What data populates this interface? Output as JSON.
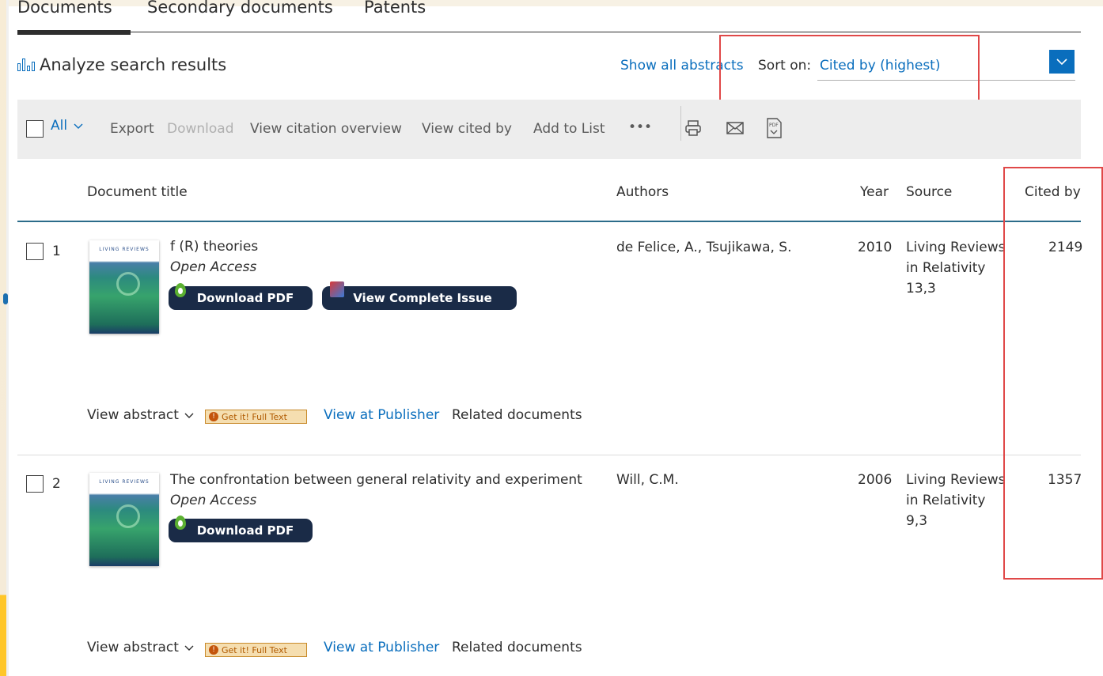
{
  "tabs": [
    {
      "label": "Documents"
    },
    {
      "label": "Secondary documents"
    },
    {
      "label": "Patents"
    }
  ],
  "analyze": {
    "label": "Analyze search results",
    "icon": "bar-chart-icon"
  },
  "show_all_abstracts": "Show all abstracts",
  "sort": {
    "label": "Sort on:",
    "value": "Cited by (highest)",
    "button_icon": "chevron-down-icon"
  },
  "toolbar": {
    "all_label": "All",
    "export": "Export",
    "download": "Download",
    "view_citation_overview": "View citation overview",
    "view_cited_by": "View cited by",
    "add_to_list": "Add to List",
    "more": "•••",
    "icons": [
      "print-icon",
      "email-icon",
      "pdf-icon"
    ]
  },
  "table_header": {
    "document_title": "Document title",
    "authors": "Authors",
    "year": "Year",
    "source": "Source",
    "cited_by": "Cited by"
  },
  "results": [
    {
      "num": "1",
      "title": "f (R) theories",
      "access": "Open Access",
      "authors": "de Felice, A., Tsujikawa, S.",
      "year": "2010",
      "source_line1": "Living Reviews",
      "source_line2": "in Relativity",
      "source_line3": "13,3",
      "cited_by": "2149",
      "buttons": [
        "Download PDF",
        "View Complete Issue"
      ],
      "view_abstract": "View abstract",
      "get_it": "Get it! Full Text",
      "view_at_publisher": "View at Publisher",
      "related_documents": "Related documents"
    },
    {
      "num": "2",
      "title": "The confrontation between general relativity and experiment",
      "access": "Open Access",
      "authors": "Will, C.M.",
      "year": "2006",
      "source_line1": "Living Reviews",
      "source_line2": "in Relativity",
      "source_line3": "9,3",
      "cited_by": "1357",
      "buttons": [
        "Download PDF"
      ],
      "view_abstract": "View abstract",
      "get_it": "Get it! Full Text",
      "view_at_publisher": "View at Publisher",
      "related_documents": "Related documents"
    }
  ],
  "thumbnail_logo": "LIVING  REVIEWS",
  "colors": {
    "link": "#0a6ebd",
    "highlight": "#e04848",
    "button": "#1a2b47",
    "header_rule": "#2c6c8a"
  }
}
